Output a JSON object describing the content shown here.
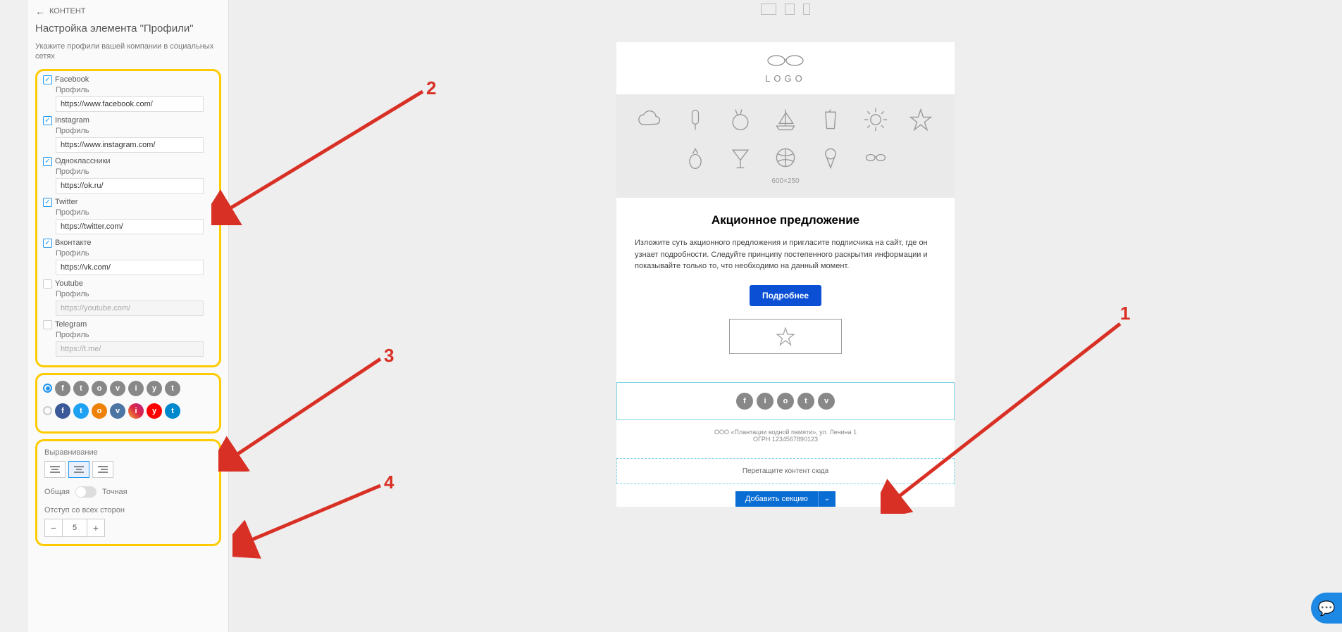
{
  "sidebar": {
    "back": "КОНТЕНТ",
    "title": "Настройка элемента \"Профили\"",
    "desc": "Укажите профили вашей компании в социальных сетях",
    "profiles": [
      {
        "name": "Facebook",
        "checked": true,
        "label": "Профиль",
        "url": "https://www.facebook.com/"
      },
      {
        "name": "Instagram",
        "checked": true,
        "label": "Профиль",
        "url": "https://www.instagram.com/"
      },
      {
        "name": "Одноклассники",
        "checked": true,
        "label": "Профиль",
        "url": "https://ok.ru/"
      },
      {
        "name": "Twitter",
        "checked": true,
        "label": "Профиль",
        "url": "https://twitter.com/"
      },
      {
        "name": "Вконтакте",
        "checked": true,
        "label": "Профиль",
        "url": "https://vk.com/"
      },
      {
        "name": "Youtube",
        "checked": false,
        "label": "Профиль",
        "url": "https://youtube.com/"
      },
      {
        "name": "Telegram",
        "checked": false,
        "label": "Профиль",
        "url": "https://t.me/"
      }
    ],
    "align_label": "Выравнивание",
    "toggle_left": "Общая",
    "toggle_right": "Точная",
    "spacing_label": "Отступ со всех сторон",
    "spacing_value": "5"
  },
  "icons": {
    "fb": "f",
    "tw": "t",
    "ok": "o",
    "vk": "v",
    "ig": "i",
    "yt": "y",
    "tg": "t"
  },
  "email": {
    "logo": "LOGO",
    "hero_dim": "600×250",
    "heading": "Акционное предложение",
    "body": "Изложите суть акционного предложения и пригласите подписчика на сайт, где он узнает подробности. Следуйте принципу постепенного раскрытия информации и показывайте только то, что необходимо на данный момент.",
    "cta": "Подробнее",
    "footer1": "ООО «Плантации водной памяти», ул. Ленина 1",
    "footer2": "ОГРН 1234567890123",
    "dropzone": "Перетащите контент сюда",
    "add_section": "Добавить секцию"
  },
  "annotations": {
    "n1": "1",
    "n2": "2",
    "n3": "3",
    "n4": "4"
  }
}
